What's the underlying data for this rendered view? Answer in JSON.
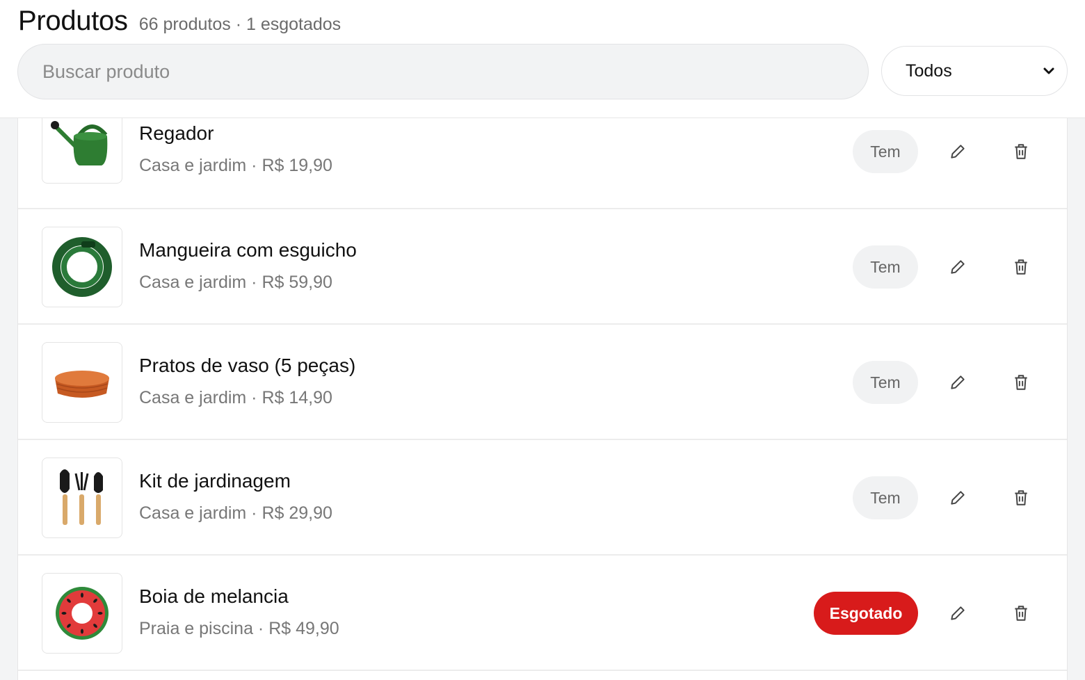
{
  "header": {
    "title": "Produtos",
    "subtitle": "66 produtos · 1 esgotados"
  },
  "search": {
    "placeholder": "Buscar produto",
    "value": ""
  },
  "filter": {
    "selected": "Todos"
  },
  "colors": {
    "accent_out_of_stock": "#d81b1b",
    "badge_in_stock_bg": "#f1f2f3"
  },
  "products": [
    {
      "name": "Regador",
      "meta": "Casa e jardim · R$ 19,90",
      "status": "Tem",
      "image": "watering-can-image"
    },
    {
      "name": "Mangueira com esguicho",
      "meta": "Casa e jardim · R$ 59,90",
      "status": "Tem",
      "image": "garden-hose-image"
    },
    {
      "name": "Pratos de vaso (5 peças)",
      "meta": "Casa e jardim · R$ 14,90",
      "status": "Tem",
      "image": "plant-saucers-image"
    },
    {
      "name": "Kit de jardinagem",
      "meta": "Casa e jardim · R$ 29,90",
      "status": "Tem",
      "image": "gardening-tools-image"
    },
    {
      "name": "Boia de melancia",
      "meta": "Praia e piscina · R$ 49,90",
      "status": "Esgotado",
      "image": "watermelon-float-image"
    }
  ]
}
